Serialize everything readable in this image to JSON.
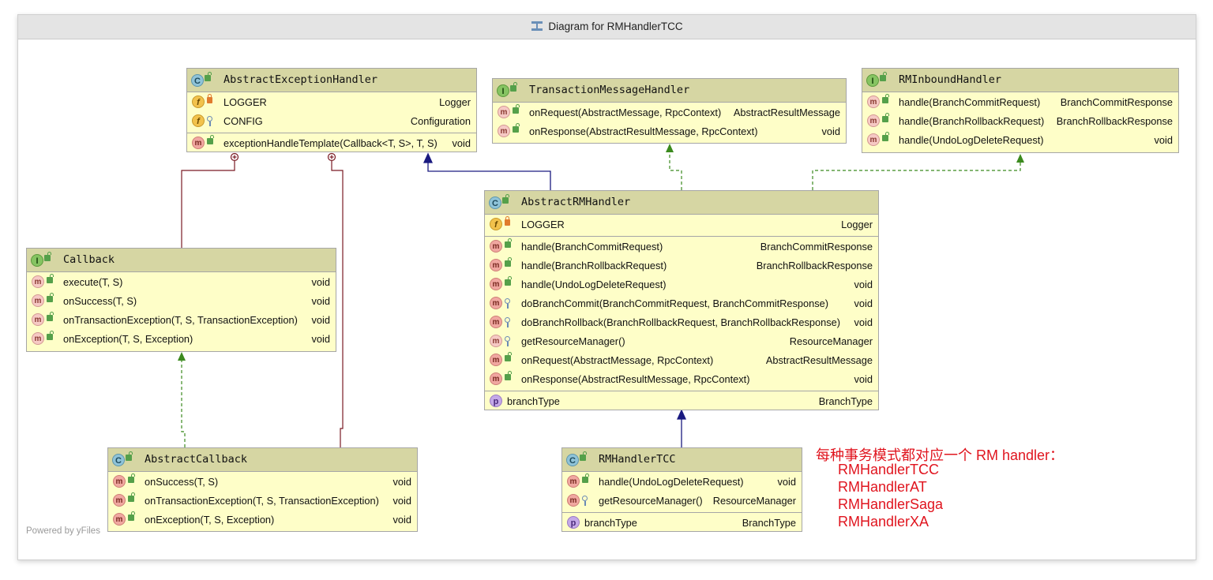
{
  "window": {
    "title": "Diagram for RMHandlerTCC",
    "footer": "Powered by yFiles"
  },
  "note": {
    "heading": "每种事务模式都对应一个 RM handler：",
    "items": [
      "RMHandlerTCC",
      "RMHandlerAT",
      "RMHandlerSaga",
      "RMHandlerXA"
    ]
  },
  "classes": {
    "aeh": {
      "name": "AbstractExceptionHandler",
      "kind": "C",
      "fields": [
        {
          "name": "LOGGER",
          "type": "Logger"
        },
        {
          "name": "CONFIG",
          "type": "Configuration"
        }
      ],
      "methods": [
        {
          "name": "exceptionHandleTemplate(Callback<T, S>, T, S)",
          "type": "void"
        }
      ]
    },
    "tmh": {
      "name": "TransactionMessageHandler",
      "kind": "I",
      "methods": [
        {
          "name": "onRequest(AbstractMessage, RpcContext)",
          "type": "AbstractResultMessage"
        },
        {
          "name": "onResponse(AbstractResultMessage, RpcContext)",
          "type": "void"
        }
      ]
    },
    "rmi": {
      "name": "RMInboundHandler",
      "kind": "I",
      "methods": [
        {
          "name": "handle(BranchCommitRequest)",
          "type": "BranchCommitResponse"
        },
        {
          "name": "handle(BranchRollbackRequest)",
          "type": "BranchRollbackResponse"
        },
        {
          "name": "handle(UndoLogDeleteRequest)",
          "type": "void"
        }
      ]
    },
    "arm": {
      "name": "AbstractRMHandler",
      "kind": "C",
      "fields": [
        {
          "name": "LOGGER",
          "type": "Logger"
        }
      ],
      "methods": [
        {
          "name": "handle(BranchCommitRequest)",
          "type": "BranchCommitResponse"
        },
        {
          "name": "handle(BranchRollbackRequest)",
          "type": "BranchRollbackResponse"
        },
        {
          "name": "handle(UndoLogDeleteRequest)",
          "type": "void"
        },
        {
          "name": "doBranchCommit(BranchCommitRequest, BranchCommitResponse)",
          "type": "void"
        },
        {
          "name": "doBranchRollback(BranchRollbackRequest, BranchRollbackResponse)",
          "type": "void"
        },
        {
          "name": "getResourceManager()",
          "type": "ResourceManager"
        },
        {
          "name": "onRequest(AbstractMessage, RpcContext)",
          "type": "AbstractResultMessage"
        },
        {
          "name": "onResponse(AbstractResultMessage, RpcContext)",
          "type": "void"
        }
      ],
      "properties": [
        {
          "name": "branchType",
          "type": "BranchType"
        }
      ]
    },
    "cb": {
      "name": "Callback",
      "kind": "I",
      "methods": [
        {
          "name": "execute(T, S)",
          "type": "void"
        },
        {
          "name": "onSuccess(T, S)",
          "type": "void"
        },
        {
          "name": "onTransactionException(T, S, TransactionException)",
          "type": "void"
        },
        {
          "name": "onException(T, S, Exception)",
          "type": "void"
        }
      ]
    },
    "acb": {
      "name": "AbstractCallback",
      "kind": "C",
      "methods": [
        {
          "name": "onSuccess(T, S)",
          "type": "void"
        },
        {
          "name": "onTransactionException(T, S, TransactionException)",
          "type": "void"
        },
        {
          "name": "onException(T, S, Exception)",
          "type": "void"
        }
      ]
    },
    "tcc": {
      "name": "RMHandlerTCC",
      "kind": "C",
      "methods": [
        {
          "name": "handle(UndoLogDeleteRequest)",
          "type": "void"
        },
        {
          "name": "getResourceManager()",
          "type": "ResourceManager"
        }
      ],
      "properties": [
        {
          "name": "branchType",
          "type": "BranchType"
        }
      ]
    }
  }
}
